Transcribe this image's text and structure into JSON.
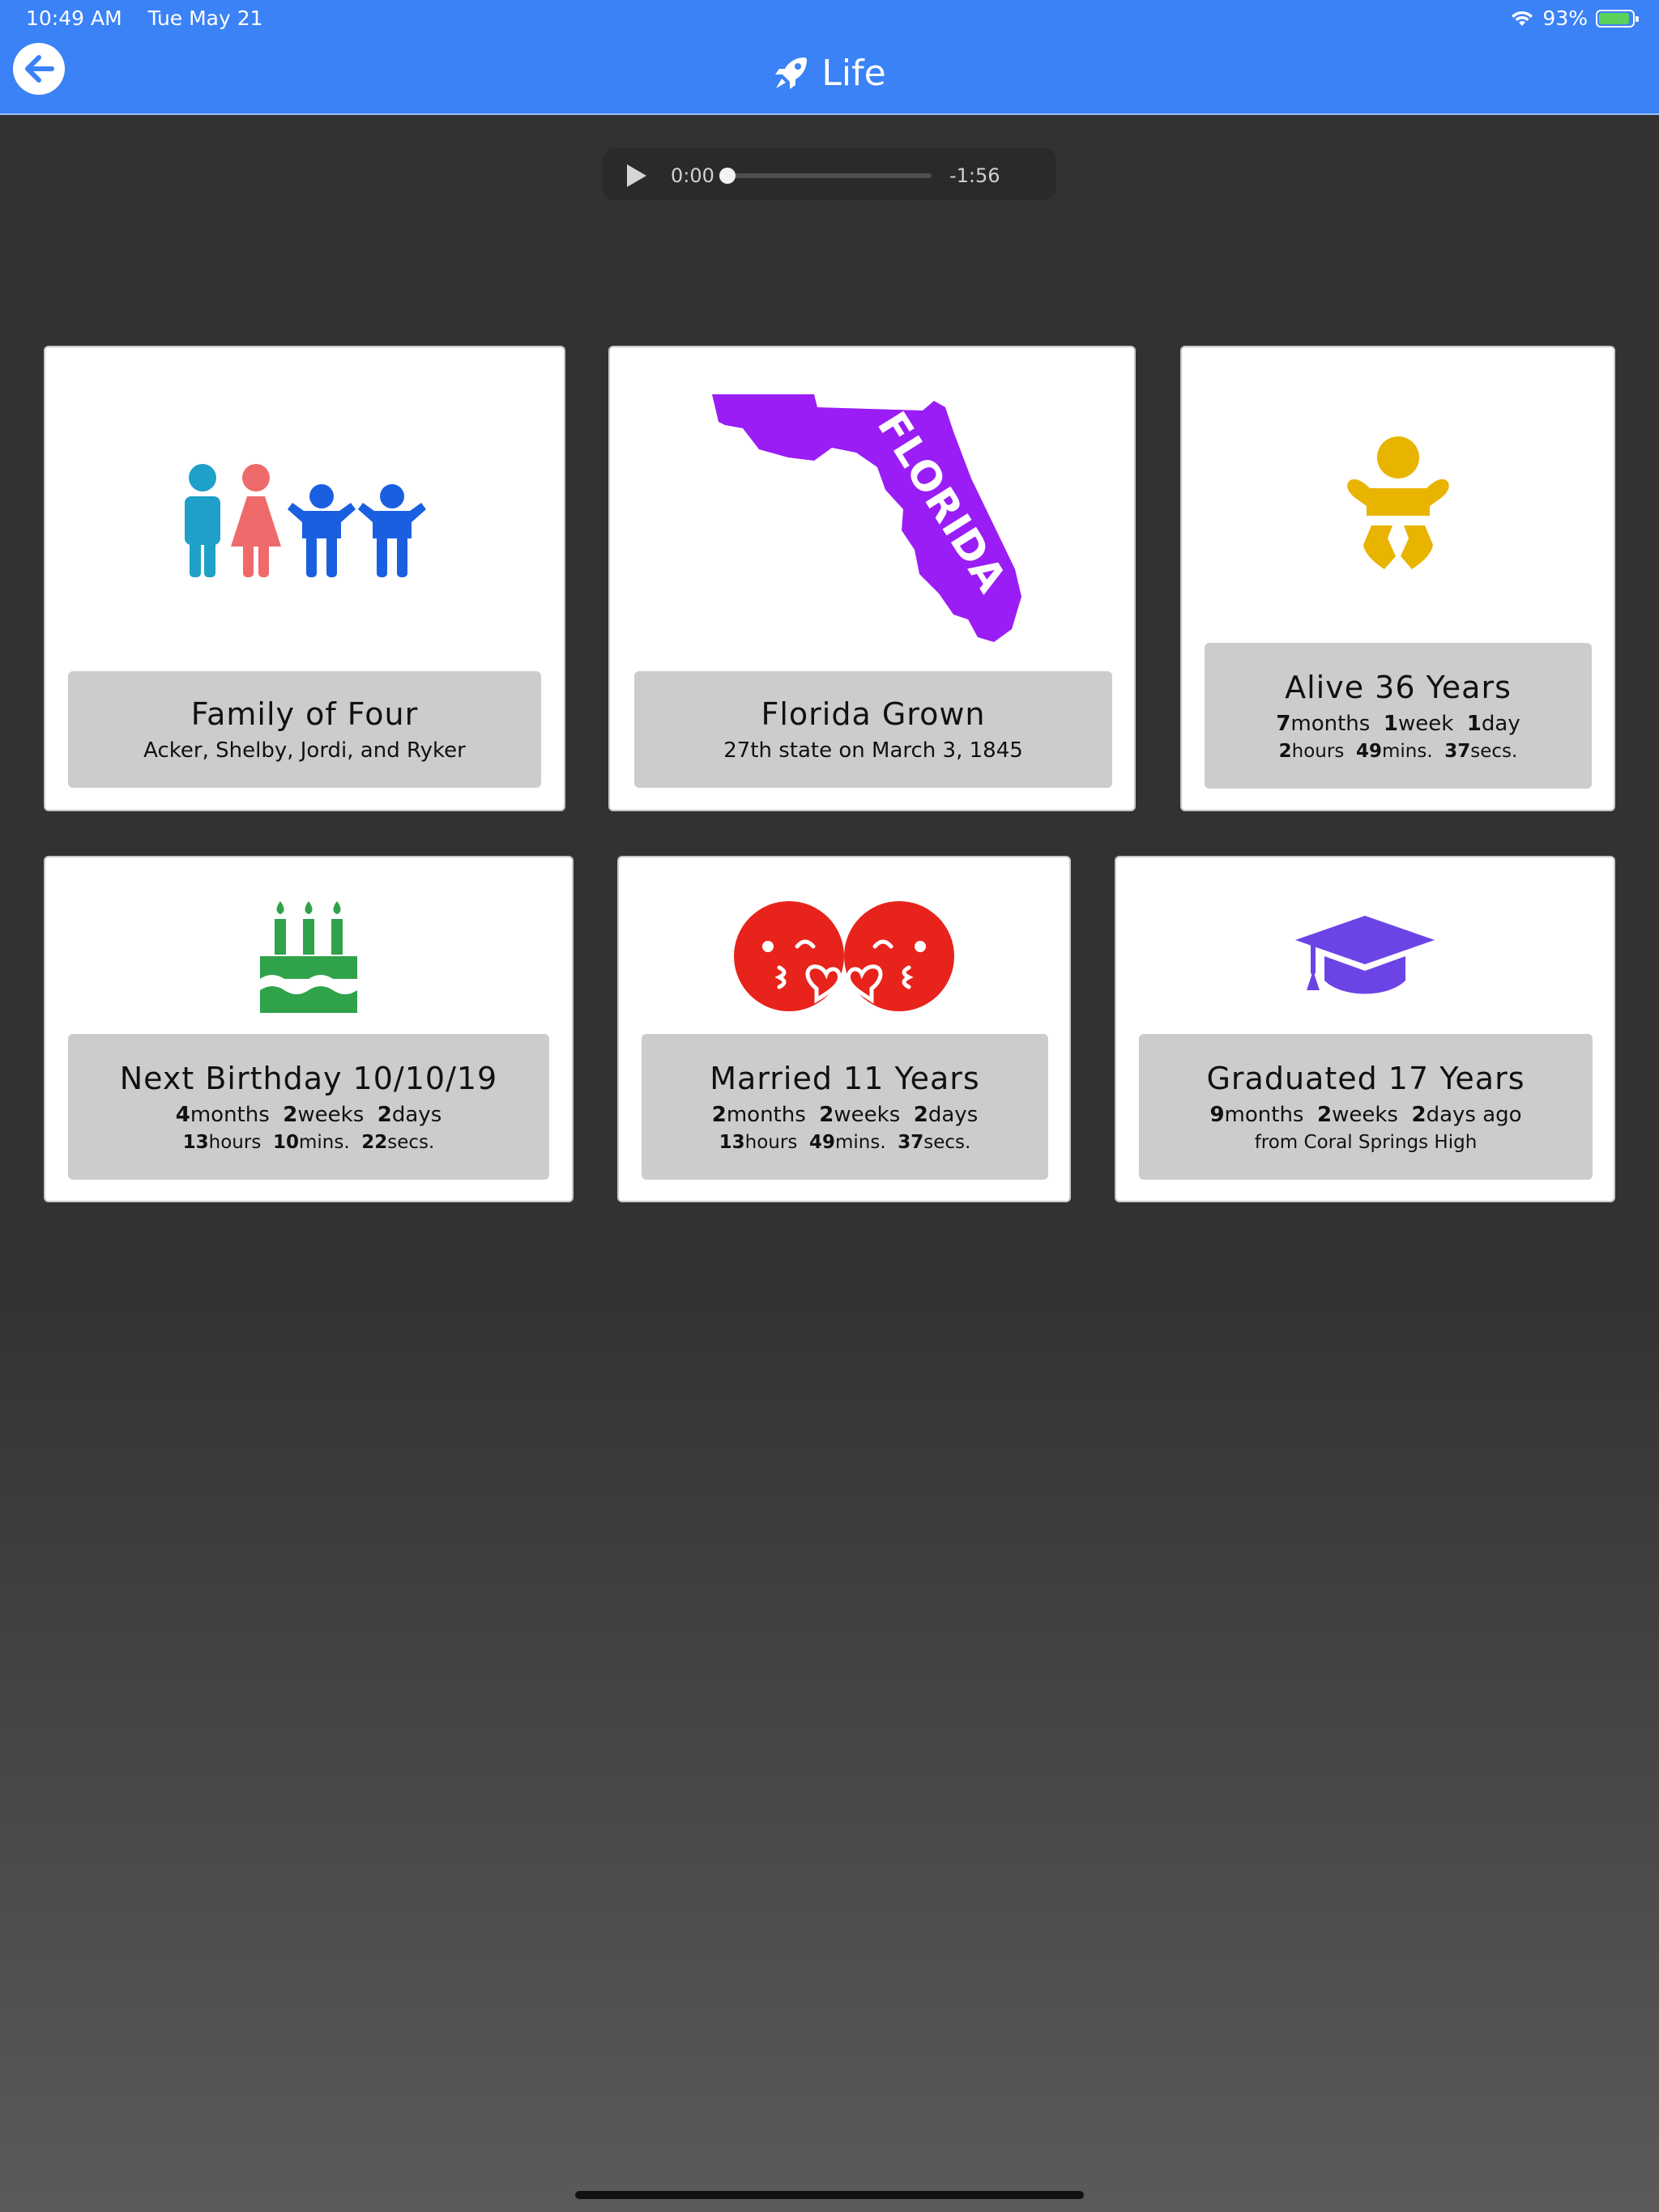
{
  "status_bar": {
    "time": "10:49 AM",
    "date": "Tue May 21",
    "battery": "93%",
    "battery_level": 0.93
  },
  "nav": {
    "title": "Life",
    "title_icon": "rocket-icon",
    "back_icon": "arrow-left-icon"
  },
  "audio": {
    "current": "0:00",
    "remaining": "-1:56",
    "progress": 0
  },
  "cards": {
    "family": {
      "title": "Family of Four",
      "subtitle": "Acker, Shelby, Jordi, and Ryker",
      "icon": "family-icon"
    },
    "florida": {
      "title": "Florida Grown",
      "subtitle": "27th state on March 3, 1845",
      "icon": "florida-map-icon",
      "map_label": "FLORIDA"
    },
    "alive": {
      "title": "Alive 36 Years",
      "icon": "baby-icon",
      "l1": {
        "a": "7",
        "a_unit": "months",
        "b": "1",
        "b_unit": "week",
        "c": "1",
        "c_unit": "day"
      },
      "l2": {
        "a": "2",
        "a_unit": "hours",
        "b": "49",
        "b_unit": "mins.",
        "c": "37",
        "c_unit": "secs."
      }
    },
    "birthday": {
      "title": "Next Birthday 10/10/19",
      "icon": "birthday-cake-icon",
      "l1": {
        "a": "4",
        "a_unit": "months",
        "b": "2",
        "b_unit": "weeks",
        "c": "2",
        "c_unit": "days"
      },
      "l2": {
        "a": "13",
        "a_unit": "hours",
        "b": "10",
        "b_unit": "mins.",
        "c": "22",
        "c_unit": "secs."
      }
    },
    "married": {
      "title": "Married 11 Years",
      "icon": "kissing-faces-icon",
      "l1": {
        "a": "2",
        "a_unit": "months",
        "b": "2",
        "b_unit": "weeks",
        "c": "2",
        "c_unit": "days"
      },
      "l2": {
        "a": "13",
        "a_unit": "hours",
        "b": "49",
        "b_unit": "mins.",
        "c": "37",
        "c_unit": "secs."
      }
    },
    "graduated": {
      "title": "Graduated 17 Years",
      "icon": "graduation-cap-icon",
      "l1": {
        "a": "9",
        "a_unit": "months",
        "b": "2",
        "b_unit": "weeks",
        "c": "2",
        "c_unit": "days ago"
      },
      "note": "from Coral Springs High"
    }
  },
  "colors": {
    "nav": "#3b82f6",
    "family_man": "#1ea0c8",
    "family_woman": "#ef6a6a",
    "family_kids": "#1a5fe0",
    "florida": "#9a1df6",
    "baby": "#e8b400",
    "cake": "#2fa24a",
    "married": "#e8231b",
    "grad": "#6c44e6"
  }
}
